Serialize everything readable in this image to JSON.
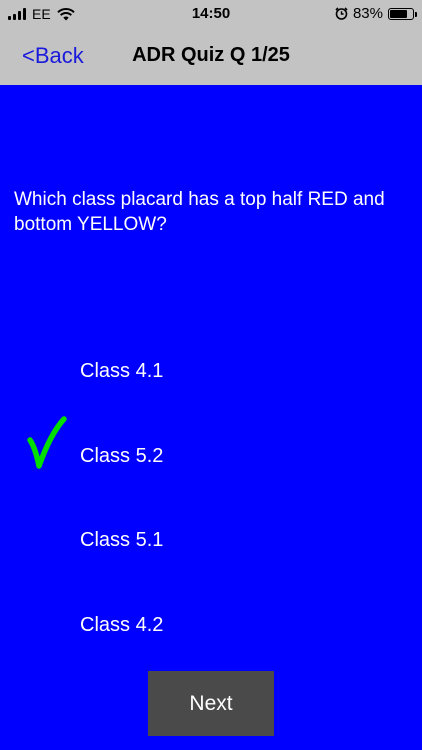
{
  "status_bar": {
    "carrier": "EE",
    "time": "14:50",
    "battery": "83%",
    "battery_level": 0.83
  },
  "nav": {
    "back_label": "<Back",
    "title": "ADR Quiz Q 1/25"
  },
  "question": {
    "text": "Which class placard has a top half RED and bottom YELLOW?"
  },
  "answers": [
    {
      "label": "Class 4.1",
      "selected": false
    },
    {
      "label": "Class 5.2",
      "selected": true
    },
    {
      "label": "Class 5.1",
      "selected": false
    },
    {
      "label": "Class 4.2",
      "selected": false
    }
  ],
  "next_label": "Next",
  "colors": {
    "background": "#0000fe",
    "bar": "#c3c3c3",
    "back_link": "#1a1adc",
    "check": "#00e000",
    "next_button": "#4a4a4a"
  }
}
